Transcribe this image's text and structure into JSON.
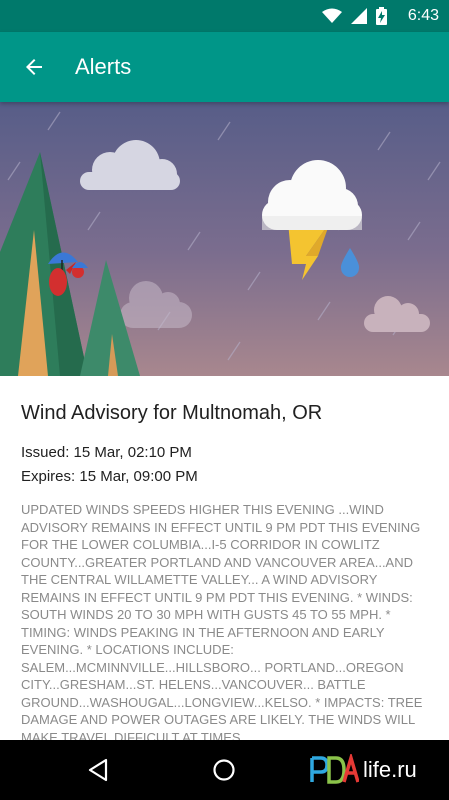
{
  "status_bar": {
    "time": "6:43",
    "battery_icon": "battery-charging-icon",
    "signal_icon": "cell-signal-icon",
    "wifi_icon": "wifi-icon"
  },
  "app_bar": {
    "title": "Alerts",
    "back_icon": "arrow-back-icon",
    "color": "#009688",
    "status_color": "#00796B"
  },
  "hero": {
    "description_icons": [
      "cloud-icon",
      "thunder-cloud-icon",
      "rain-drop-icon",
      "tree-icon",
      "bird-icon"
    ]
  },
  "alert": {
    "title": "Wind Advisory for Multnomah, OR",
    "issued": "Issued: 15 Mar, 02:10 PM",
    "expires": "Expires: 15 Mar, 09:00 PM",
    "body": "UPDATED WINDS SPEEDS HIGHER THIS EVENING ...WIND ADVISORY REMAINS IN EFFECT UNTIL 9 PM PDT THIS EVENING FOR THE LOWER COLUMBIA...I-5 CORRIDOR IN COWLITZ COUNTY...GREATER PORTLAND AND VANCOUVER AREA...AND THE CENTRAL WILLAMETTE VALLEY... A WIND ADVISORY REMAINS IN EFFECT UNTIL 9 PM PDT THIS EVENING. * WINDS: SOUTH WINDS 20 TO 30 MPH WITH GUSTS 45 TO 55 MPH. * TIMING: WINDS PEAKING IN THE AFTERNOON AND EARLY EVENING. * LOCATIONS INCLUDE: SALEM...MCMINNVILLE...HILLSBORO... PORTLAND...OREGON CITY...GRESHAM...ST. HELENS...VANCOUVER... BATTLE GROUND...WASHOUGAL...LONGVIEW...KELSO. * IMPACTS: TREE DAMAGE AND POWER OUTAGES ARE LIKELY. THE WINDS WILL MAKE TRAVEL DIFFICULT AT TIMES."
  },
  "nav_bar": {
    "back_icon": "nav-back-icon",
    "home_icon": "nav-home-icon"
  },
  "watermark": {
    "text": "life.ru",
    "logo": "PDA"
  }
}
